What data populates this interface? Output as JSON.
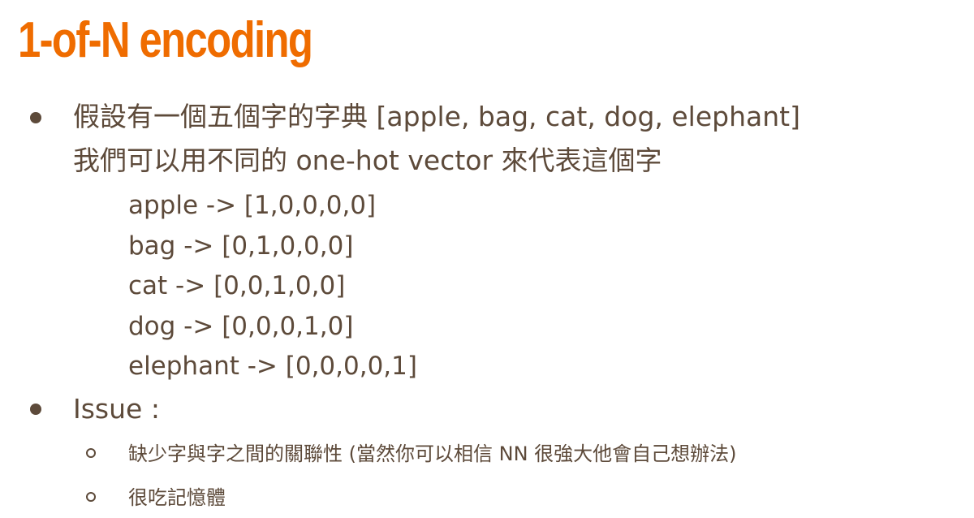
{
  "title": "1-of-N encoding",
  "bullets": {
    "intro_line1": "假設有一個五個字的字典 [apple, bag, cat, dog, elephant]",
    "intro_line2": "我們可以用不同的 one-hot vector 來代表這個字",
    "examples": [
      "apple -> [1,0,0,0,0]",
      "bag -> [0,1,0,0,0]",
      "cat -> [0,0,1,0,0]",
      "dog -> [0,0,0,1,0]",
      "elephant -> [0,0,0,0,1]"
    ],
    "issue_label": "Issue :",
    "issue_subitems": [
      "缺少字與字之間的關聯性 (當然你可以相信 NN 很強大他會自己想辦法)",
      "很吃記憶體"
    ]
  },
  "colors": {
    "title": "#ef6c00",
    "body_text": "#5d4a3a",
    "background": "#ffffff"
  }
}
